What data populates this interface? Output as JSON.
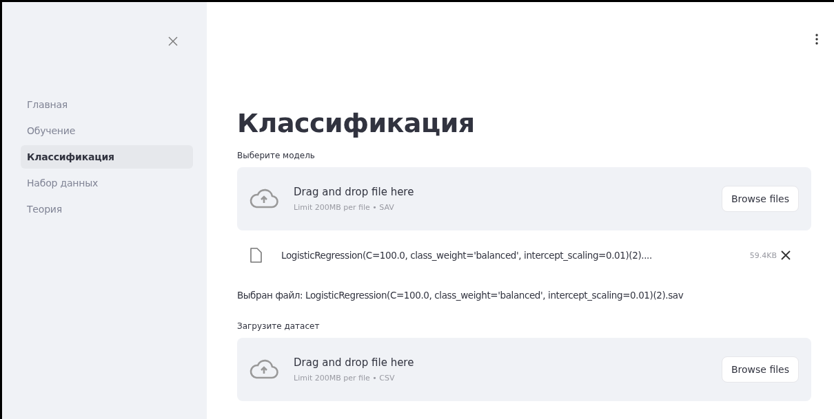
{
  "sidebar": {
    "items": [
      {
        "label": "Главная",
        "selected": false
      },
      {
        "label": "Обучение",
        "selected": false
      },
      {
        "label": "Классификация",
        "selected": true
      },
      {
        "label": "Набор данных",
        "selected": false
      },
      {
        "label": "Теория",
        "selected": false
      }
    ]
  },
  "main": {
    "title": "Классификация",
    "sections": [
      {
        "kind": "uploader",
        "label": "Выберите модель",
        "dropzone": {
          "text": "Drag and drop file here",
          "limit": "Limit 200MB per file • SAV",
          "button": "Browse files"
        },
        "file": {
          "name": "LogisticRegression(C=100.0, class_weight='balanced', intercept_scaling=0.01)(2)....",
          "size": "59.4KB"
        }
      },
      {
        "kind": "text",
        "text": "Выбран файл: LogisticRegression(C=100.0, class_weight='balanced', intercept_scaling=0.01)(2).sav"
      },
      {
        "kind": "uploader",
        "label": "Загрузите датасет",
        "dropzone": {
          "text": "Drag and drop file here",
          "limit": "Limit 200MB per file • CSV",
          "button": "Browse files"
        }
      }
    ]
  }
}
